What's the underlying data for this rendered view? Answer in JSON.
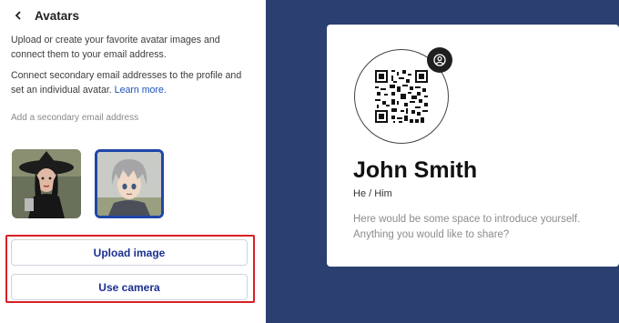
{
  "header": {
    "title": "Avatars"
  },
  "intro": {
    "text": "Upload or create your favorite avatar images and connect them to your email address."
  },
  "secondary": {
    "text": "Connect secondary email addresses to the profile and set an individual avatar.",
    "link": "Learn more."
  },
  "email_field": {
    "placeholder": "Add a secondary email address"
  },
  "avatars": {
    "selected_index": 1
  },
  "buttons": {
    "upload": "Upload image",
    "camera": "Use camera"
  },
  "profile": {
    "name": "John Smith",
    "pronouns": "He / Him",
    "bio": "Here would be some space to introduce yourself. Anything you would like to share?"
  },
  "icons": {
    "back": "chevron-left-icon",
    "avatar": "avatar-face-icon",
    "qr": "qr-code"
  },
  "colors": {
    "accent": "#1a2f8f",
    "link": "#1a53b8",
    "selected_border": "#1f46a8",
    "highlight": "#d91f26",
    "right_bg": "#2b3f70"
  }
}
